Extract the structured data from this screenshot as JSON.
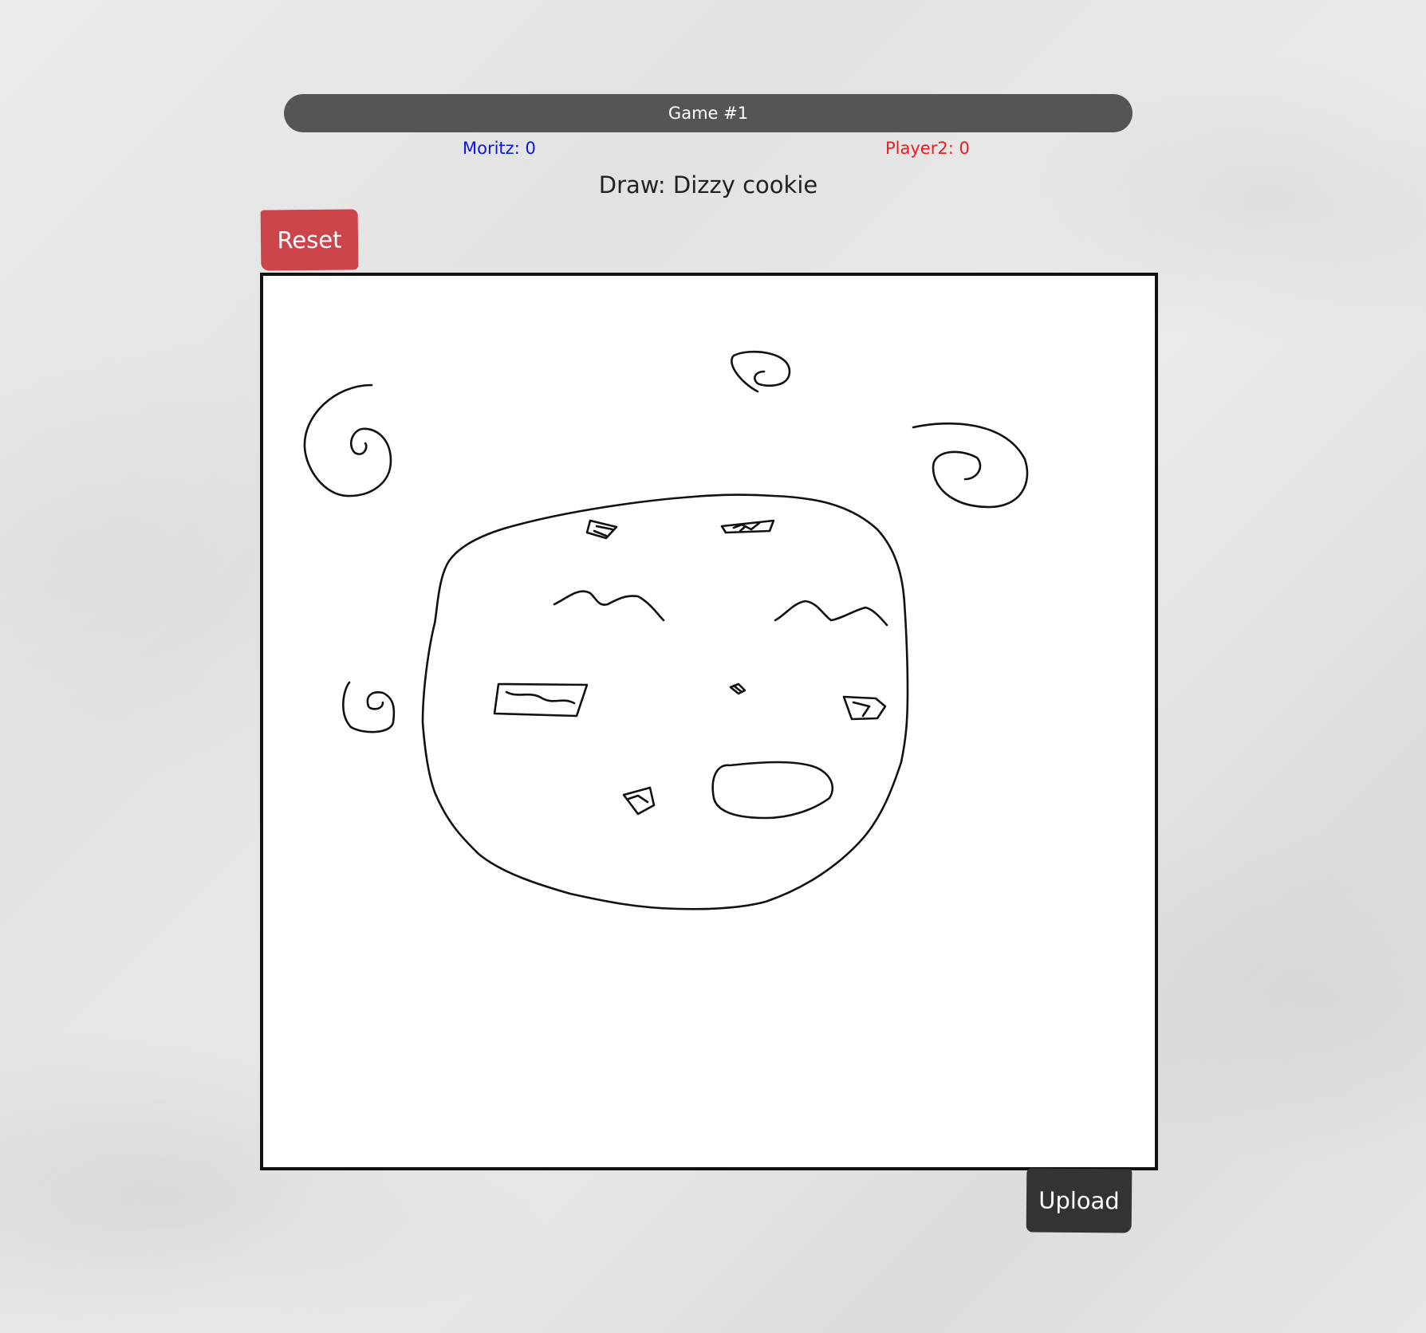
{
  "game": {
    "title": "Game #1"
  },
  "scores": {
    "player1": {
      "text": "Moritz: 0",
      "color": "#0a14e6"
    },
    "player2": {
      "text": "Player2: 0",
      "color": "#ee1c1c"
    }
  },
  "prompt": {
    "text": "Draw: Dizzy cookie"
  },
  "buttons": {
    "reset_label": "Reset",
    "upload_label": "Upload"
  },
  "colors": {
    "title_bar": "#555555",
    "reset_button": "#cc454b",
    "upload_button": "#333333",
    "canvas_border": "#111111"
  }
}
